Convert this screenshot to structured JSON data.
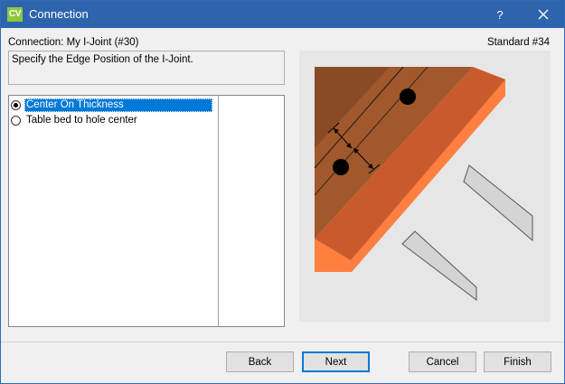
{
  "window": {
    "app_icon": "CV",
    "title": "Connection",
    "help": "?",
    "close_icon": "close-icon"
  },
  "header": {
    "connection": "Connection: My I-Joint (#30)",
    "standard": "Standard #34"
  },
  "instruction": "Specify the Edge Position of the I-Joint.",
  "options": [
    {
      "label": "Center On Thickness",
      "checked": true
    },
    {
      "label": "Table bed to hole center",
      "checked": false
    }
  ],
  "buttons": {
    "back": "Back",
    "next": "Next",
    "cancel": "Cancel",
    "finish": "Finish"
  },
  "colors": {
    "titlebar": "#2d64ad",
    "selection": "#0078d7",
    "board_top": "#a0582c",
    "board_edge": "#ff7f40"
  }
}
